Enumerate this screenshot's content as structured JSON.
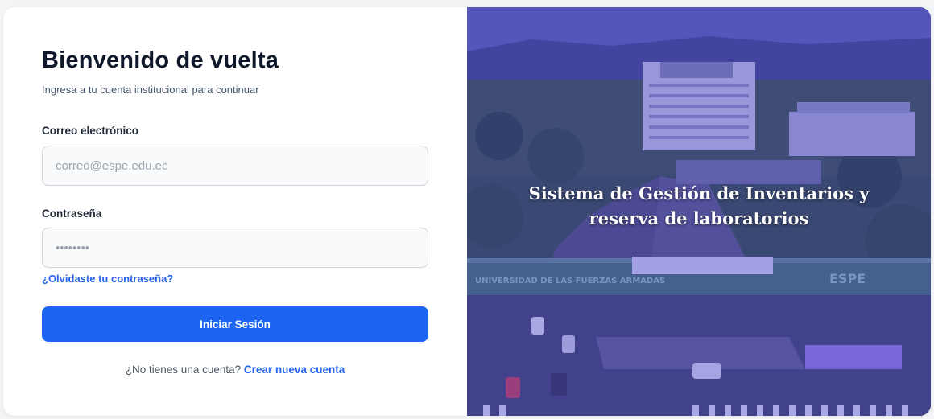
{
  "login": {
    "title": "Bienvenido de vuelta",
    "subtitle": "Ingresa a tu cuenta institucional para continuar",
    "email_label": "Correo electrónico",
    "email_placeholder": "correo@espe.edu.ec",
    "password_label": "Contraseña",
    "password_value": "••••••••",
    "forgot_link": "¿Olvidaste tu contraseña?",
    "submit_label": "Iniciar Sesión",
    "signup_prompt": "¿No tienes una cuenta?",
    "signup_link": "Crear nueva cuenta"
  },
  "hero": {
    "line1": "Sistema de Gestión de Inventarios y",
    "line2": "reserva de laboratorios",
    "sign_left": "UNIVERSIDAD DE LAS FUERZAS ARMADAS",
    "sign_right": "ESPE"
  },
  "colors": {
    "accent": "#1d64f2",
    "link": "#2563eb",
    "overlay": "#5046dc"
  }
}
